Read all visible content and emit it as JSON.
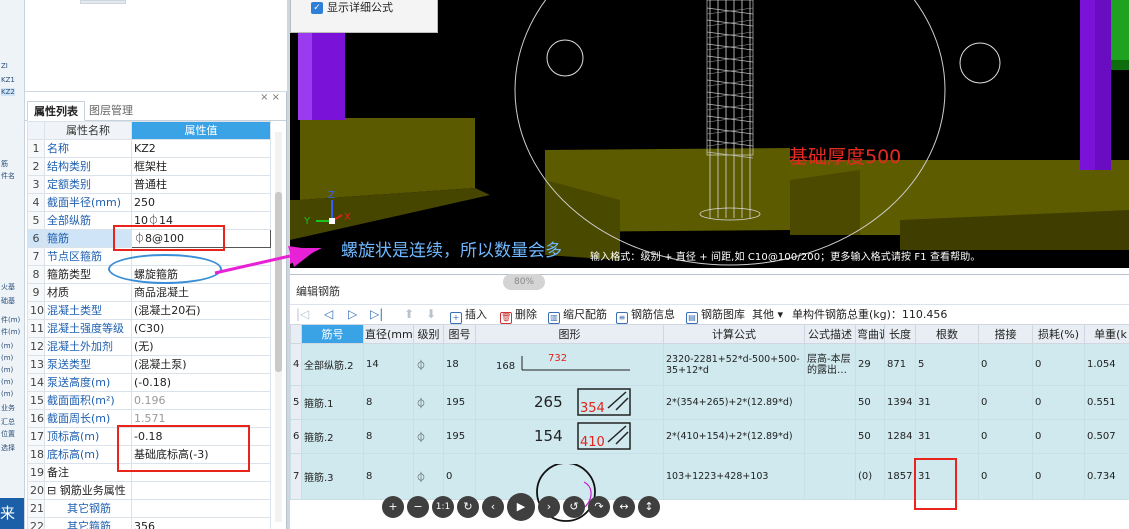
{
  "left_strip": {
    "items": [
      "ZI",
      "KZ1",
      "KZ2",
      "筋",
      "件名",
      "火基",
      "础基",
      "件(m)",
      "件(m)",
      "(m)",
      "(m)",
      "(m)",
      "(m)",
      "(m)",
      "业务",
      "汇总",
      "位置",
      "选择"
    ],
    "bottom_logo": "来"
  },
  "property_panel": {
    "tabs": [
      "属性列表",
      "图层管理"
    ],
    "headers": {
      "num": "",
      "name": "属性名称",
      "value": "属性值"
    },
    "rows": [
      {
        "num": "1",
        "name": "名称",
        "value": "KZ2"
      },
      {
        "num": "2",
        "name": "结构类别",
        "value": "框架柱"
      },
      {
        "num": "3",
        "name": "定额类别",
        "value": "普通柱"
      },
      {
        "num": "4",
        "name": "截面半径(mm)",
        "value": "250"
      },
      {
        "num": "5",
        "name": "全部纵筋",
        "value": "10⏀14"
      },
      {
        "num": "6",
        "name": "箍筋",
        "value": "⏀8@100"
      },
      {
        "num": "7",
        "name": "节点区箍筋",
        "value": ""
      },
      {
        "num": "8",
        "name": "箍筋类型",
        "value": "螺旋箍筋"
      },
      {
        "num": "9",
        "name": "材质",
        "value": "商品混凝土"
      },
      {
        "num": "10",
        "name": "混凝土类型",
        "value": "(混凝土20石)"
      },
      {
        "num": "11",
        "name": "混凝土强度等级",
        "value": "(C30)"
      },
      {
        "num": "12",
        "name": "混凝土外加剂",
        "value": "(无)"
      },
      {
        "num": "13",
        "name": "泵送类型",
        "value": "(混凝土泵)"
      },
      {
        "num": "14",
        "name": "泵送高度(m)",
        "value": "(-0.18)"
      },
      {
        "num": "15",
        "name": "截面面积(m²)",
        "value": "0.196"
      },
      {
        "num": "16",
        "name": "截面周长(m)",
        "value": "1.571"
      },
      {
        "num": "17",
        "name": "顶标高(m)",
        "value": "-0.18"
      },
      {
        "num": "18",
        "name": "底标高(m)",
        "value": "基础底标高(-3)"
      },
      {
        "num": "19",
        "name": "备注",
        "value": ""
      },
      {
        "num": "20",
        "name": "⊟ 钢筋业务属性",
        "value": ""
      },
      {
        "num": "21",
        "name": "其它钢筋",
        "value": ""
      },
      {
        "num": "22",
        "name": "其它箍筋",
        "value": "356"
      }
    ]
  },
  "viewport": {
    "show_detail_label": "显示详细公式",
    "foundation_label": "基础厚度500",
    "spiral_note": "螺旋状是连续，所以数量会多",
    "format_hint": "输入格式：级别 + 直径 + 间距,如 C10@100/200；更多输入格式请按 F1 查看帮助。",
    "zoom": "80%",
    "axis_z": "Z",
    "axis_y": "Y",
    "axis_x": "X"
  },
  "rebar_editor": {
    "title": "编辑钢筋",
    "toolbar": {
      "insert": "插入",
      "delete": "删除",
      "scale": "缩尺配筋",
      "info": "钢筋信息",
      "library": "钢筋图库",
      "other": "其他",
      "total": "单构件钢筋总重(kg)：110.456"
    },
    "headers": [
      "",
      "筋号",
      "直径(mm)",
      "级别",
      "图号",
      "图形",
      "计算公式",
      "公式描述",
      "弯曲调整",
      "长度",
      "根数",
      "搭接",
      "损耗(%)",
      "单重(k"
    ],
    "rows": [
      {
        "num": "4",
        "name": "全部纵筋.2",
        "diameter": "14",
        "grade": "⏀",
        "fig": "18",
        "shape": {
          "a": "168",
          "b": "732"
        },
        "formula": "2320-2281+52*d-500+500-35+12*d",
        "desc": "层高-本层的露出…",
        "bend": "29",
        "length": "871",
        "count": "5",
        "lap": "0",
        "loss": "0",
        "unit_weight": "1.054"
      },
      {
        "num": "5",
        "name": "箍筋.1",
        "diameter": "8",
        "grade": "⏀",
        "fig": "195",
        "shape": {
          "a": "265",
          "b": "354"
        },
        "formula": "2*(354+265)+2*(12.89*d)",
        "desc": "",
        "bend": "50",
        "length": "1394",
        "count": "31",
        "lap": "0",
        "loss": "0",
        "unit_weight": "0.551"
      },
      {
        "num": "6",
        "name": "箍筋.2",
        "diameter": "8",
        "grade": "⏀",
        "fig": "195",
        "shape": {
          "a": "154",
          "b": "410"
        },
        "formula": "2*(410+154)+2*(12.89*d)",
        "desc": "",
        "bend": "50",
        "length": "1284",
        "count": "31",
        "lap": "0",
        "loss": "0",
        "unit_weight": "0.507"
      },
      {
        "num": "7",
        "name": "箍筋.3",
        "diameter": "8",
        "grade": "⏀",
        "fig": "0",
        "shape": {
          "a": "",
          "b": ""
        },
        "formula": "103+1223+428+103",
        "desc": "",
        "bend": "(0)",
        "length": "1857",
        "count": "31",
        "lap": "0",
        "loss": "0",
        "unit_weight": "0.734"
      }
    ]
  },
  "controls": [
    "+",
    "−",
    "1:1",
    "↻",
    "‹",
    "▶",
    "›",
    "↺",
    "↷",
    "↔",
    "↕"
  ],
  "colors": {
    "header_blue": "#3aa3e6",
    "annotation_red": "#e8241c",
    "annotation_blue": "#3a8ed8",
    "row_teal": "#cfe9ee",
    "column_purple": "#7b12d8",
    "slab_olive": "#5c5a00"
  }
}
